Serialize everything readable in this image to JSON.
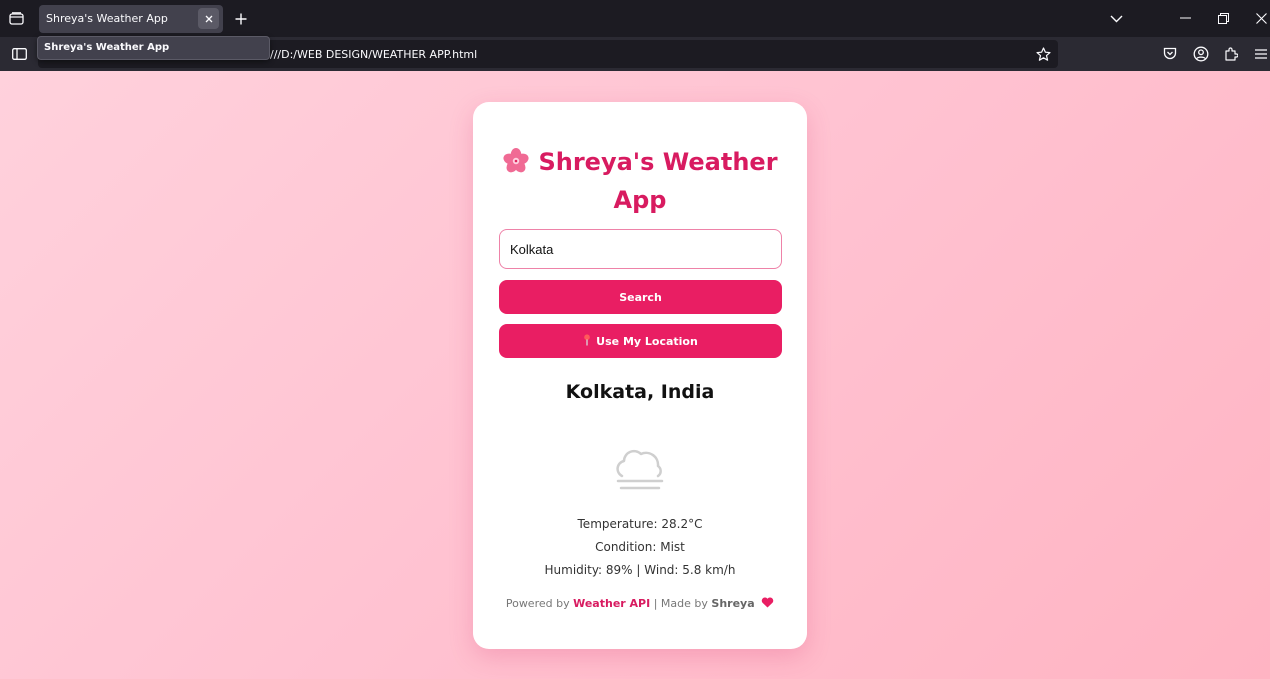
{
  "browser": {
    "tab_title": "Shreya's Weather App",
    "tooltip_text": "Shreya's Weather App",
    "url": "///D:/WEB DESIGN/WEATHER APP.html"
  },
  "app": {
    "title_line1": "Shreya's Weather",
    "title_line2": "App",
    "title_icon": "cherry-blossom-icon",
    "search": {
      "value": "Kolkata"
    },
    "search_button": "Search",
    "location_button": "Use My Location",
    "location_button_icon": "pushpin-icon",
    "location_name": "Kolkata, India",
    "weather_icon": "fog-cloud-icon",
    "temperature": "Temperature: 28.2°C",
    "condition": "Condition: Mist",
    "humidity_wind": "Humidity: 89% | Wind: 5.8 km/h",
    "footer": {
      "powered_prefix": "Powered by",
      "api_name": "Weather API",
      "separator": "| Made by",
      "author": "Shreya",
      "heart_icon": "heart-icon"
    }
  },
  "colors": {
    "accent": "#e91e63",
    "title": "#d81b60",
    "background_start": "#ffd1dc",
    "background_end": "#ffb4c3"
  }
}
